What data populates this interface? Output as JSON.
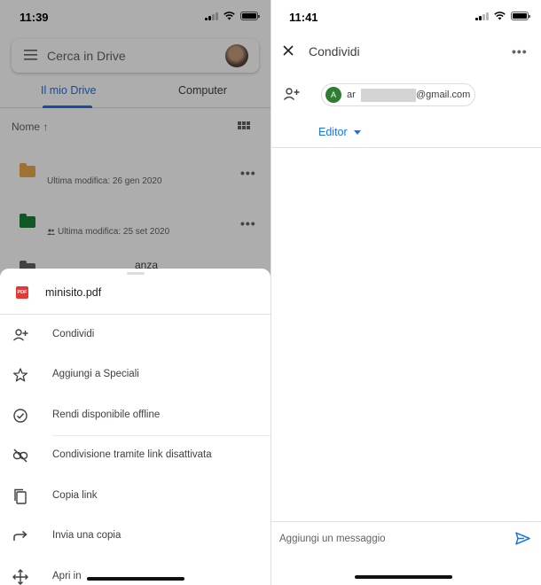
{
  "left": {
    "status": {
      "time": "11:39"
    },
    "search": {
      "placeholder": "Cerca in Drive"
    },
    "tabs": {
      "my_drive": "Il mio Drive",
      "computer": "Computer"
    },
    "sort": {
      "label": "Nome ↑"
    },
    "files": [
      {
        "subtitle": "Ultima modifica: 26 gen 2020",
        "folder_color": "#e8a94a"
      },
      {
        "subtitle": "Ultima modifica: 25 set 2020",
        "shared": true,
        "folder_color": "#188038"
      },
      {
        "title_fragment": "anza",
        "folder_color": "#5f6368"
      }
    ],
    "sheet": {
      "file_icon_text": "PDF",
      "file_name": "minisito.pdf",
      "items": [
        {
          "label": "Condividi",
          "icon": "add-person-icon"
        },
        {
          "label": "Aggiungi a Speciali",
          "icon": "star-icon"
        },
        {
          "label": "Rendi disponibile offline",
          "icon": "offline-check-icon"
        },
        {
          "label": "Condivisione tramite link disattivata",
          "icon": "link-off-icon"
        },
        {
          "label": "Copia link",
          "icon": "copy-icon"
        },
        {
          "label": "Invia una copia",
          "icon": "forward-icon"
        },
        {
          "label": "Apri in",
          "icon": "move-icon"
        }
      ]
    }
  },
  "right": {
    "status": {
      "time": "11:41"
    },
    "title": "Condividi",
    "more": "•••",
    "recipient": {
      "avatar_letter": "A",
      "email_prefix": "ar",
      "email_suffix": "@gmail.com"
    },
    "role": "Editor",
    "message_placeholder": "Aggiungi un messaggio"
  },
  "colors": {
    "accent": "#1a73e8",
    "pdf_red": "#e53935",
    "avatar_green": "#2e7d32"
  }
}
